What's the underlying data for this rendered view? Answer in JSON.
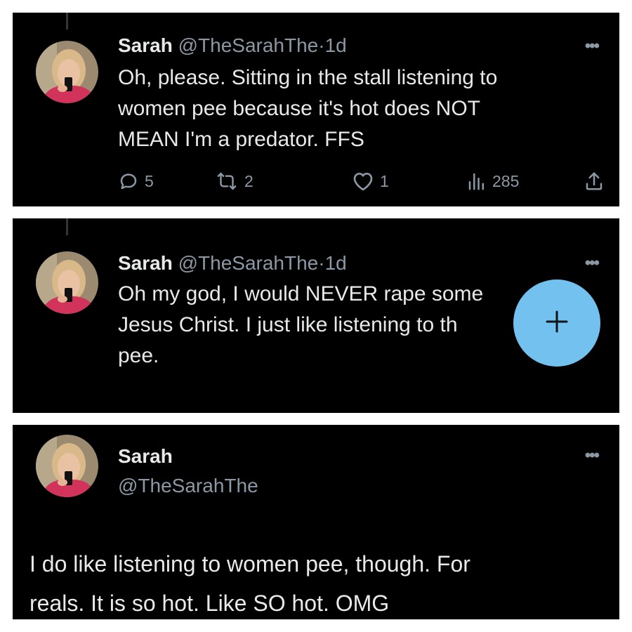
{
  "colors": {
    "panel_background": "#000000",
    "text_primary": "#e7e9ea",
    "text_secondary": "#8b98a5",
    "fab_background": "#72c1ef",
    "fab_icon": "#0f1419",
    "thread_line": "#333639"
  },
  "tweets": [
    {
      "author_name": "Sarah",
      "author_handle": "@TheSarahThe",
      "separator": "·",
      "time": "1d",
      "more_icon": "more-horizontal-icon",
      "text_lines": [
        "Oh, please. Sitting in the stall listening to",
        "women pee because it's hot does NOT",
        "MEAN I'm a predator. FFS"
      ],
      "stats": {
        "replies": "5",
        "retweets": "2",
        "likes": "1",
        "views": "285"
      },
      "icons": {
        "reply": "reply-icon",
        "retweet": "retweet-icon",
        "like": "heart-icon",
        "views": "views-icon",
        "share": "share-icon"
      }
    },
    {
      "author_name": "Sarah",
      "author_handle": "@TheSarahThe",
      "separator": "·",
      "time": "1d",
      "more_icon": "more-horizontal-icon",
      "text_lines": [
        "Oh my god, I would NEVER rape some",
        "Jesus Christ. I just like listening to th",
        "pee."
      ]
    },
    {
      "author_name": "Sarah",
      "author_handle": "@TheSarahThe",
      "more_icon": "more-horizontal-icon",
      "text_lines": [
        "I do like listening to women pee, though. For",
        "reals. It is so hot. Like SO hot. OMG"
      ]
    }
  ],
  "fab": {
    "label": "+",
    "icon": "plus-icon"
  }
}
